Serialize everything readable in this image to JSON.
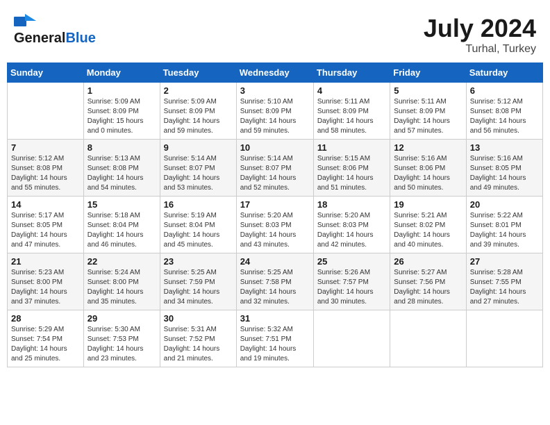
{
  "header": {
    "logo_general": "General",
    "logo_blue": "Blue",
    "month_year": "July 2024",
    "location": "Turhal, Turkey"
  },
  "columns": [
    "Sunday",
    "Monday",
    "Tuesday",
    "Wednesday",
    "Thursday",
    "Friday",
    "Saturday"
  ],
  "weeks": [
    {
      "days": [
        {
          "num": "",
          "info": ""
        },
        {
          "num": "1",
          "info": "Sunrise: 5:09 AM\nSunset: 8:09 PM\nDaylight: 15 hours\nand 0 minutes."
        },
        {
          "num": "2",
          "info": "Sunrise: 5:09 AM\nSunset: 8:09 PM\nDaylight: 14 hours\nand 59 minutes."
        },
        {
          "num": "3",
          "info": "Sunrise: 5:10 AM\nSunset: 8:09 PM\nDaylight: 14 hours\nand 59 minutes."
        },
        {
          "num": "4",
          "info": "Sunrise: 5:11 AM\nSunset: 8:09 PM\nDaylight: 14 hours\nand 58 minutes."
        },
        {
          "num": "5",
          "info": "Sunrise: 5:11 AM\nSunset: 8:09 PM\nDaylight: 14 hours\nand 57 minutes."
        },
        {
          "num": "6",
          "info": "Sunrise: 5:12 AM\nSunset: 8:08 PM\nDaylight: 14 hours\nand 56 minutes."
        }
      ]
    },
    {
      "days": [
        {
          "num": "7",
          "info": "Sunrise: 5:12 AM\nSunset: 8:08 PM\nDaylight: 14 hours\nand 55 minutes."
        },
        {
          "num": "8",
          "info": "Sunrise: 5:13 AM\nSunset: 8:08 PM\nDaylight: 14 hours\nand 54 minutes."
        },
        {
          "num": "9",
          "info": "Sunrise: 5:14 AM\nSunset: 8:07 PM\nDaylight: 14 hours\nand 53 minutes."
        },
        {
          "num": "10",
          "info": "Sunrise: 5:14 AM\nSunset: 8:07 PM\nDaylight: 14 hours\nand 52 minutes."
        },
        {
          "num": "11",
          "info": "Sunrise: 5:15 AM\nSunset: 8:06 PM\nDaylight: 14 hours\nand 51 minutes."
        },
        {
          "num": "12",
          "info": "Sunrise: 5:16 AM\nSunset: 8:06 PM\nDaylight: 14 hours\nand 50 minutes."
        },
        {
          "num": "13",
          "info": "Sunrise: 5:16 AM\nSunset: 8:05 PM\nDaylight: 14 hours\nand 49 minutes."
        }
      ]
    },
    {
      "days": [
        {
          "num": "14",
          "info": "Sunrise: 5:17 AM\nSunset: 8:05 PM\nDaylight: 14 hours\nand 47 minutes."
        },
        {
          "num": "15",
          "info": "Sunrise: 5:18 AM\nSunset: 8:04 PM\nDaylight: 14 hours\nand 46 minutes."
        },
        {
          "num": "16",
          "info": "Sunrise: 5:19 AM\nSunset: 8:04 PM\nDaylight: 14 hours\nand 45 minutes."
        },
        {
          "num": "17",
          "info": "Sunrise: 5:20 AM\nSunset: 8:03 PM\nDaylight: 14 hours\nand 43 minutes."
        },
        {
          "num": "18",
          "info": "Sunrise: 5:20 AM\nSunset: 8:03 PM\nDaylight: 14 hours\nand 42 minutes."
        },
        {
          "num": "19",
          "info": "Sunrise: 5:21 AM\nSunset: 8:02 PM\nDaylight: 14 hours\nand 40 minutes."
        },
        {
          "num": "20",
          "info": "Sunrise: 5:22 AM\nSunset: 8:01 PM\nDaylight: 14 hours\nand 39 minutes."
        }
      ]
    },
    {
      "days": [
        {
          "num": "21",
          "info": "Sunrise: 5:23 AM\nSunset: 8:00 PM\nDaylight: 14 hours\nand 37 minutes."
        },
        {
          "num": "22",
          "info": "Sunrise: 5:24 AM\nSunset: 8:00 PM\nDaylight: 14 hours\nand 35 minutes."
        },
        {
          "num": "23",
          "info": "Sunrise: 5:25 AM\nSunset: 7:59 PM\nDaylight: 14 hours\nand 34 minutes."
        },
        {
          "num": "24",
          "info": "Sunrise: 5:25 AM\nSunset: 7:58 PM\nDaylight: 14 hours\nand 32 minutes."
        },
        {
          "num": "25",
          "info": "Sunrise: 5:26 AM\nSunset: 7:57 PM\nDaylight: 14 hours\nand 30 minutes."
        },
        {
          "num": "26",
          "info": "Sunrise: 5:27 AM\nSunset: 7:56 PM\nDaylight: 14 hours\nand 28 minutes."
        },
        {
          "num": "27",
          "info": "Sunrise: 5:28 AM\nSunset: 7:55 PM\nDaylight: 14 hours\nand 27 minutes."
        }
      ]
    },
    {
      "days": [
        {
          "num": "28",
          "info": "Sunrise: 5:29 AM\nSunset: 7:54 PM\nDaylight: 14 hours\nand 25 minutes."
        },
        {
          "num": "29",
          "info": "Sunrise: 5:30 AM\nSunset: 7:53 PM\nDaylight: 14 hours\nand 23 minutes."
        },
        {
          "num": "30",
          "info": "Sunrise: 5:31 AM\nSunset: 7:52 PM\nDaylight: 14 hours\nand 21 minutes."
        },
        {
          "num": "31",
          "info": "Sunrise: 5:32 AM\nSunset: 7:51 PM\nDaylight: 14 hours\nand 19 minutes."
        },
        {
          "num": "",
          "info": ""
        },
        {
          "num": "",
          "info": ""
        },
        {
          "num": "",
          "info": ""
        }
      ]
    }
  ]
}
